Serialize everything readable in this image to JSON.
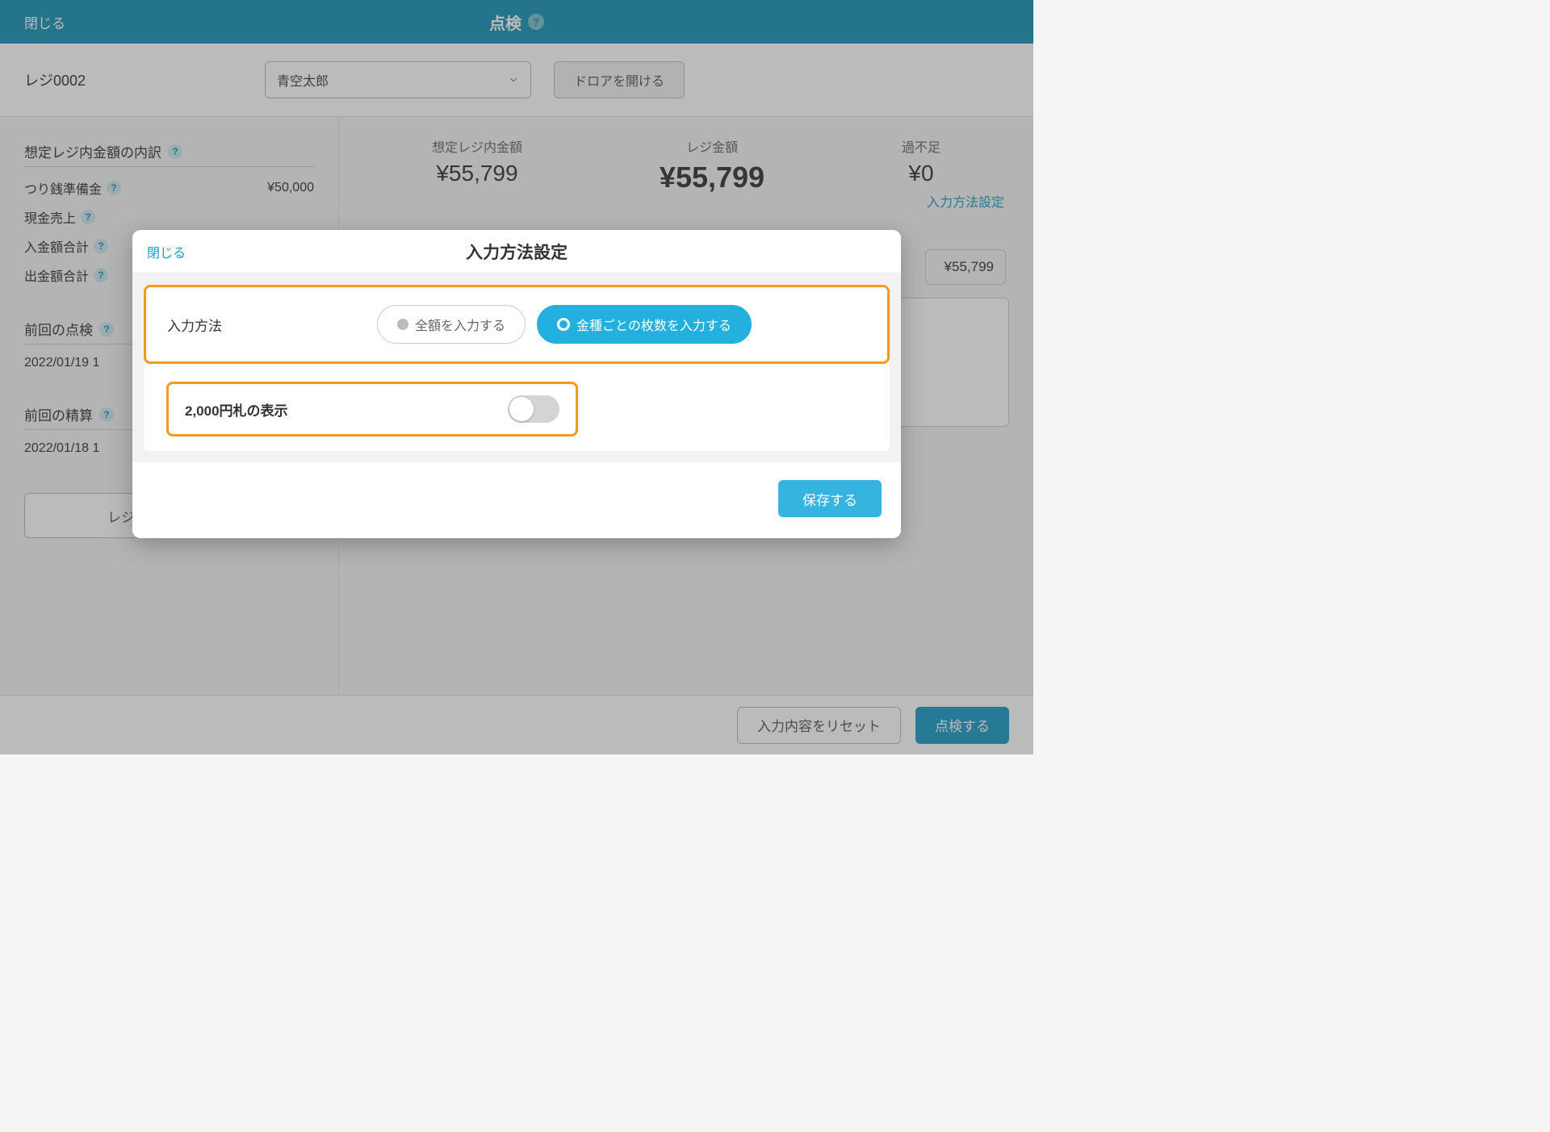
{
  "header": {
    "close_label": "閉じる",
    "title": "点検"
  },
  "register_row": {
    "register_name": "レジ0002",
    "staff_name": "青空太郎",
    "open_drawer_label": "ドロアを開ける"
  },
  "sidebar": {
    "breakdown_title": "想定レジ内金額の内訳",
    "items": [
      {
        "label": "つり銭準備金",
        "value": "¥50,000"
      },
      {
        "label": "現金売上",
        "value": ""
      },
      {
        "label": "入金額合計",
        "value": ""
      },
      {
        "label": "出金額合計",
        "value": ""
      }
    ],
    "last_inspection_title": "前回の点検",
    "last_inspection_value": "2022/01/19 1",
    "last_settlement_title": "前回の精算",
    "last_settlement_value": "2022/01/18 1",
    "history_button_label": "レジ点検・精算履歴"
  },
  "content": {
    "expected_amount_label": "想定レジ内金額",
    "expected_amount_value": "¥55,799",
    "register_amount_label": "レジ金額",
    "register_amount_value": "¥55,799",
    "diff_label": "過不足",
    "diff_value": "¥0",
    "settings_link_label": "入力方法設定",
    "amount_display": "¥55,799"
  },
  "footer": {
    "reset_label": "入力内容をリセット",
    "inspect_label": "点検する"
  },
  "modal": {
    "close_label": "閉じる",
    "title": "入力方法設定",
    "input_method_label": "入力方法",
    "option_full_amount": "全額を入力する",
    "option_by_denomination": "金種ごとの枚数を入力する",
    "two_thousand_label": "2,000円札の表示",
    "save_label": "保存する"
  }
}
